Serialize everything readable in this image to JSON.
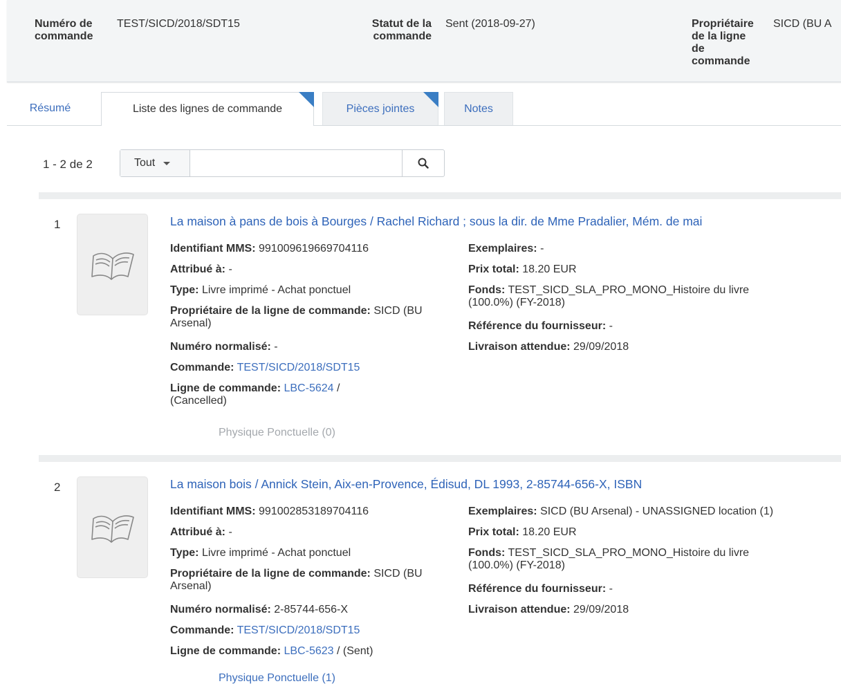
{
  "header": {
    "order_number_label": "Numéro de commande",
    "order_number_value": "TEST/SICD/2018/SDT15",
    "order_status_label": "Statut de la commande",
    "order_status_value": "Sent (2018-09-27)",
    "pol_owner_label": "Propriétaire de la ligne de commande",
    "pol_owner_value": "SICD (BU A"
  },
  "tabs": [
    {
      "label": "Résumé"
    },
    {
      "label": "Liste des lignes de commande"
    },
    {
      "label": "Pièces jointes"
    },
    {
      "label": "Notes"
    }
  ],
  "results": {
    "count": "1 - 2 de 2",
    "scope": "Tout",
    "search_value": ""
  },
  "lines": [
    {
      "num": "1",
      "title": "La maison à pans de bois à Bourges / Rachel Richard ; sous la dir. de Mme Pradalier, Mém. de mai",
      "mms_label": "Identifiant MMS:",
      "mms_value": "991009619669704116",
      "assigned_label": "Attribué à:",
      "assigned_value": "-",
      "type_label": "Type:",
      "type_value": "Livre imprimé - Achat ponctuel",
      "owner_label": "Propriétaire de la ligne de commande:",
      "owner_value": "SICD (BU Arsenal)",
      "std_label": "Numéro normalisé:",
      "std_value": "-",
      "order_label": "Commande:",
      "order_value": "TEST/SICD/2018/SDT15",
      "pol_label": "Ligne de commande:",
      "pol_value": "LBC-5624",
      "pol_status": "/ (Cancelled)",
      "copies_label": "Exemplaires:",
      "copies_value": "-",
      "price_label": "Prix total:",
      "price_value": "18.20 EUR",
      "funds_label": "Fonds:",
      "funds_value": "TEST_SICD_SLA_PRO_MONO_Histoire du livre (100.0%) (FY-2018)",
      "vendor_ref_label": "Référence du fournisseur:",
      "vendor_ref_value": "-",
      "delivery_label": "Livraison attendue:",
      "delivery_value": "29/09/2018",
      "physical": "Physique Ponctuelle (0)"
    },
    {
      "num": "2",
      "title": "La maison bois / Annick Stein, Aix-en-Provence, Édisud, DL 1993, 2-85744-656-X, ISBN",
      "mms_label": "Identifiant MMS:",
      "mms_value": "991002853189704116",
      "assigned_label": "Attribué à:",
      "assigned_value": "-",
      "type_label": "Type:",
      "type_value": "Livre imprimé - Achat ponctuel",
      "owner_label": "Propriétaire de la ligne de commande:",
      "owner_value": "SICD (BU Arsenal)",
      "std_label": "Numéro normalisé:",
      "std_value": "2-85744-656-X",
      "order_label": "Commande:",
      "order_value": "TEST/SICD/2018/SDT15",
      "pol_label": "Ligne de commande:",
      "pol_value": "LBC-5623",
      "pol_status": "/ (Sent)",
      "copies_label": "Exemplaires:",
      "copies_value": "SICD (BU Arsenal) - UNASSIGNED location (1)",
      "price_label": "Prix total:",
      "price_value": "18.20 EUR",
      "funds_label": "Fonds:",
      "funds_value": "TEST_SICD_SLA_PRO_MONO_Histoire du livre (100.0%) (FY-2018)",
      "vendor_ref_label": "Référence du fournisseur:",
      "vendor_ref_value": "-",
      "delivery_label": "Livraison attendue:",
      "delivery_value": "29/09/2018",
      "physical": "Physique Ponctuelle (1)"
    }
  ]
}
